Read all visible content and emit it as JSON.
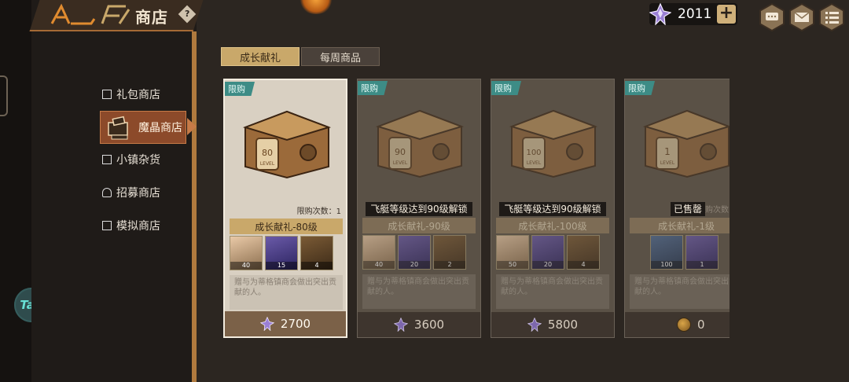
{
  "header": {
    "title": "商店",
    "help_glyph": "?",
    "currency_value": "2011",
    "plus_glyph": "+"
  },
  "sidebar": {
    "items": [
      {
        "label": "礼包商店",
        "icon": "gift-icon"
      },
      {
        "label": "魔晶商店",
        "icon": "crystal-icon",
        "active": true
      },
      {
        "label": "小镇杂货",
        "icon": "shop-icon"
      },
      {
        "label": "招募商店",
        "icon": "bell-icon"
      },
      {
        "label": "模拟商店",
        "icon": "monitor-icon"
      }
    ]
  },
  "floating": {
    "tap_label": "Tap"
  },
  "tabs": [
    {
      "label": "成长献礼",
      "active": true
    },
    {
      "label": "每周商品",
      "active": false
    }
  ],
  "cards": [
    {
      "badge": "限购",
      "chest_level_num": "80",
      "chest_level_word": "LEVEL",
      "buy_count": "限购次数：1",
      "lock_text": "",
      "name": "成长献礼-80级",
      "rewards": [
        {
          "type": "hero",
          "qty": "40"
        },
        {
          "type": "ticket",
          "qty": "15"
        },
        {
          "type": "box",
          "qty": "4"
        }
      ],
      "desc": "赠与为蒂格镇商会做出突出贡献的人。",
      "price": "2700",
      "currency": "crystal"
    },
    {
      "badge": "限购",
      "chest_level_num": "90",
      "chest_level_word": "LEVEL",
      "buy_count": "",
      "lock_text": "飞艇等级达到90级解锁",
      "name": "成长献礼-90级",
      "rewards": [
        {
          "type": "hero",
          "qty": "40"
        },
        {
          "type": "ticket",
          "qty": "20"
        },
        {
          "type": "box",
          "qty": "2"
        }
      ],
      "desc": "赠与为蒂格镇商会做出突出贡献的人。",
      "price": "3600",
      "currency": "crystal"
    },
    {
      "badge": "限购",
      "chest_level_num": "100",
      "chest_level_word": "LEVEL",
      "buy_count": "",
      "lock_text": "飞艇等级达到90级解锁",
      "name": "成长献礼-100级",
      "rewards": [
        {
          "type": "hero",
          "qty": "50"
        },
        {
          "type": "ticket",
          "qty": "20"
        },
        {
          "type": "box",
          "qty": "4"
        }
      ],
      "desc": "赠与为蒂格镇商会做出突出贡献的人。",
      "price": "5800",
      "currency": "crystal"
    },
    {
      "badge": "限购",
      "chest_level_num": "1",
      "chest_level_word": "LEVEL",
      "buy_count": "",
      "sold_text": "已售罄",
      "sold_trail": "购次数",
      "name": "成长献礼-1级",
      "rewards": [
        {
          "type": "gem",
          "qty": "100"
        },
        {
          "type": "ticket",
          "qty": "1"
        }
      ],
      "desc": "赠与为蒂格镇商会做出突出贡献的人。",
      "price": "0",
      "currency": "coin"
    }
  ],
  "colors": {
    "accent_gold": "#c9a86a",
    "badge_teal": "#3d8c86",
    "nav_active": "#8c4a2a"
  }
}
